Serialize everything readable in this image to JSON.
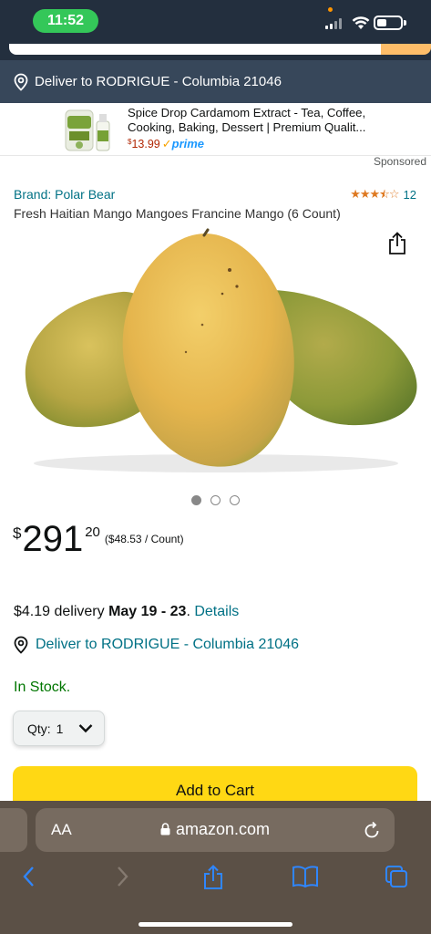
{
  "status_bar": {
    "time": "11:52"
  },
  "header": {
    "deliver_to": "Deliver to RODRIGUE - Columbia 21046"
  },
  "sponsored_ad": {
    "title": "Spice Drop Cardamom Extract - Tea, Coffee, Cooking, Baking, Dessert | Premium Qualit...",
    "price_symbol": "$",
    "price_value": "13.99",
    "prime_label": "prime",
    "sponsored_label": "Sponsored"
  },
  "product": {
    "brand": "Brand: Polar Bear",
    "rating_stars": 3.5,
    "review_count": "12",
    "title": "Fresh Haitian Mango Mangoes Francine Mango (6 Count)",
    "image_count": 3,
    "active_image": 1
  },
  "pricing": {
    "currency": "$",
    "whole": "291",
    "fraction": "20",
    "unit_price": "($48.53 / Count)"
  },
  "delivery": {
    "prefix": "$4.19 delivery ",
    "dates": "May 19 - 23",
    "separator": ". ",
    "details_link": "Details"
  },
  "deliver_line": "Deliver to RODRIGUE - Columbia 21046",
  "stock": "In Stock.",
  "quantity": {
    "label": "Qty:",
    "value": "1"
  },
  "add_to_cart": "Add to Cart",
  "browser": {
    "text_size_label": "AA",
    "domain": "amazon.com"
  },
  "colors": {
    "header_dark": "#232f3e",
    "deliver_bar": "#37475a",
    "link": "#007185",
    "in_stock": "#007600",
    "add_to_cart": "#ffd814",
    "star": "#de7921",
    "safari_bar": "#5b5046"
  }
}
